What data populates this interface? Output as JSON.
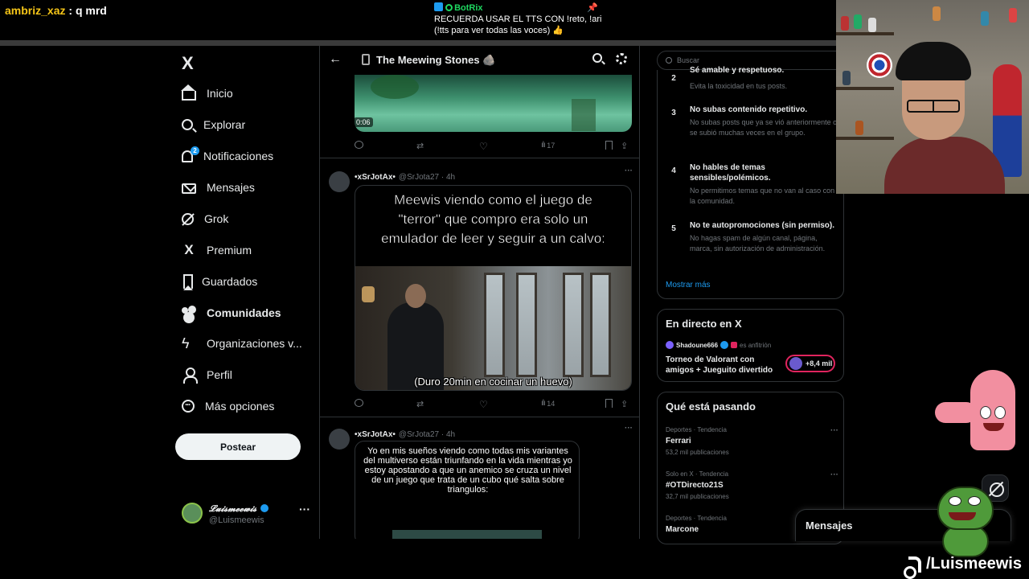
{
  "stream": {
    "chat_user": "ambriz_xaz",
    "chat_sep": " : ",
    "chat_msg": "q mrd",
    "bot_name": "BotRix",
    "bot_line1": "RECUERDA USAR EL TTS CON !reto, !ari",
    "bot_line2": "(!tts para ver todas las voces) 👍",
    "pin_icon": "📌",
    "tiktok_handle": "/Luismeewis"
  },
  "nav": {
    "logo": "X",
    "items": [
      {
        "label": "Inicio",
        "icon": "home-icon"
      },
      {
        "label": "Explorar",
        "icon": "search-icon"
      },
      {
        "label": "Notificaciones",
        "icon": "bell-icon",
        "badge": "2"
      },
      {
        "label": "Mensajes",
        "icon": "mail-icon"
      },
      {
        "label": "Grok",
        "icon": "grok-icon"
      },
      {
        "label": "Premium",
        "icon": "x-icon"
      },
      {
        "label": "Guardados",
        "icon": "bookmark-icon"
      },
      {
        "label": "Comunidades",
        "icon": "communities-icon"
      },
      {
        "label": "Organizaciones v...",
        "icon": "lightning-icon"
      },
      {
        "label": "Perfil",
        "icon": "user-icon"
      },
      {
        "label": "Más opciones",
        "icon": "more-circle-icon"
      }
    ],
    "post_button": "Postear",
    "profile_name": "𝓛𝓾𝓲𝓼𝓶𝓮𝓮𝔀𝓲𝓼",
    "profile_handle": "@Luismeewis",
    "profile_more": "···"
  },
  "header": {
    "back": "←",
    "title": "The Meewing Stones 🪨"
  },
  "feed": {
    "video_time": "0:06",
    "tweet0_views": "17",
    "tweet1": {
      "name": "•xSrJotAx•",
      "handle": "@SrJota27 · 4h",
      "meme_text": "Meewis viendo como el juego de \"terror\" que compro era solo un emulador de leer y seguir a un calvo:",
      "caption": "(Duro 20min en cocinar un huevo)",
      "views": "14"
    },
    "tweet2": {
      "name": "•xSrJotAx•",
      "handle": "@SrJota27 · 4h",
      "meme_text": "Yo en mis sueños viendo como todas mis variantes del multiverso están triunfando en la vida mientras yo estoy apostando a que un anemico se cruza un nivel de un juego que trata de un cubo qué salta sobre triangulos:"
    },
    "more": "···"
  },
  "right": {
    "search_placeholder": "Buscar",
    "rules": [
      {
        "num": "2",
        "title": "Sé amable y respetuoso.",
        "desc": "Evita la toxicidad en tus posts."
      },
      {
        "num": "3",
        "title": "No subas contenido repetitivo.",
        "desc": "No subas posts que ya se vió anteriormente o se subió muchas veces en el grupo."
      },
      {
        "num": "4",
        "title": "No hables de temas sensibles/polémicos.",
        "desc": "No permitimos temas que no van al caso con la comunidad."
      },
      {
        "num": "5",
        "title": "No te autopromociones (sin permiso).",
        "desc": "No hagas spam de algún canal, página, marca, sin autorización de administración."
      }
    ],
    "show_more": "Mostrar más",
    "live": {
      "heading": "En directo en X",
      "host": "Shadoune666",
      "role": "es anfitrión",
      "title": "Torneo de Valorant con amigos + Jueguito divertido",
      "listeners": "+8,4 mil"
    },
    "trends": {
      "heading": "Qué está pasando",
      "items": [
        {
          "meta": "Deportes · Tendencia",
          "name": "Ferrari",
          "count": "53,2 mil publicaciones"
        },
        {
          "meta": "Solo en X · Tendencia",
          "name": "#OTDirecto21S",
          "count": "32,7 mil publicaciones"
        },
        {
          "meta": "Deportes · Tendencia",
          "name": "Marcone",
          "count": ""
        }
      ]
    }
  },
  "messages": {
    "title": "Mensajes"
  }
}
